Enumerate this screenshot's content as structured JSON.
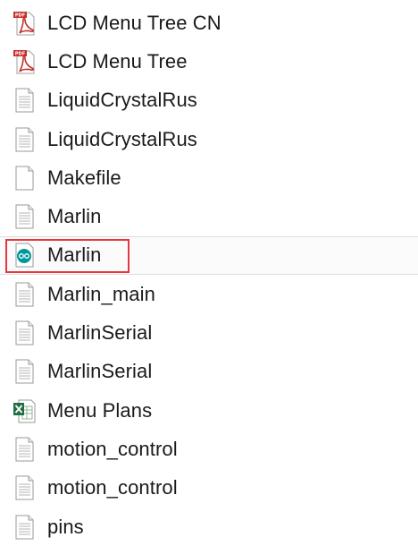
{
  "files": [
    {
      "name": "LCD Menu Tree CN",
      "icon": "pdf-file-icon",
      "selected": false
    },
    {
      "name": "LCD Menu Tree",
      "icon": "pdf-file-icon",
      "selected": false
    },
    {
      "name": "LiquidCrystalRus",
      "icon": "text-file-icon",
      "selected": false
    },
    {
      "name": "LiquidCrystalRus",
      "icon": "text-file-icon",
      "selected": false
    },
    {
      "name": "Makefile",
      "icon": "blank-file-icon",
      "selected": false
    },
    {
      "name": "Marlin",
      "icon": "text-file-icon",
      "selected": false
    },
    {
      "name": "Marlin",
      "icon": "arduino-file-icon",
      "selected": true
    },
    {
      "name": "Marlin_main",
      "icon": "text-file-icon",
      "selected": false
    },
    {
      "name": "MarlinSerial",
      "icon": "text-file-icon",
      "selected": false
    },
    {
      "name": "MarlinSerial",
      "icon": "text-file-icon",
      "selected": false
    },
    {
      "name": "Menu Plans",
      "icon": "excel-file-icon",
      "selected": false
    },
    {
      "name": "motion_control",
      "icon": "text-file-icon",
      "selected": false
    },
    {
      "name": "motion_control",
      "icon": "text-file-icon",
      "selected": false
    },
    {
      "name": "pins",
      "icon": "text-file-icon",
      "selected": false
    }
  ],
  "colors": {
    "highlight": "#e3393c",
    "pdf": "#c4302b",
    "arduino": "#00979d",
    "excel": "#1e7145"
  }
}
